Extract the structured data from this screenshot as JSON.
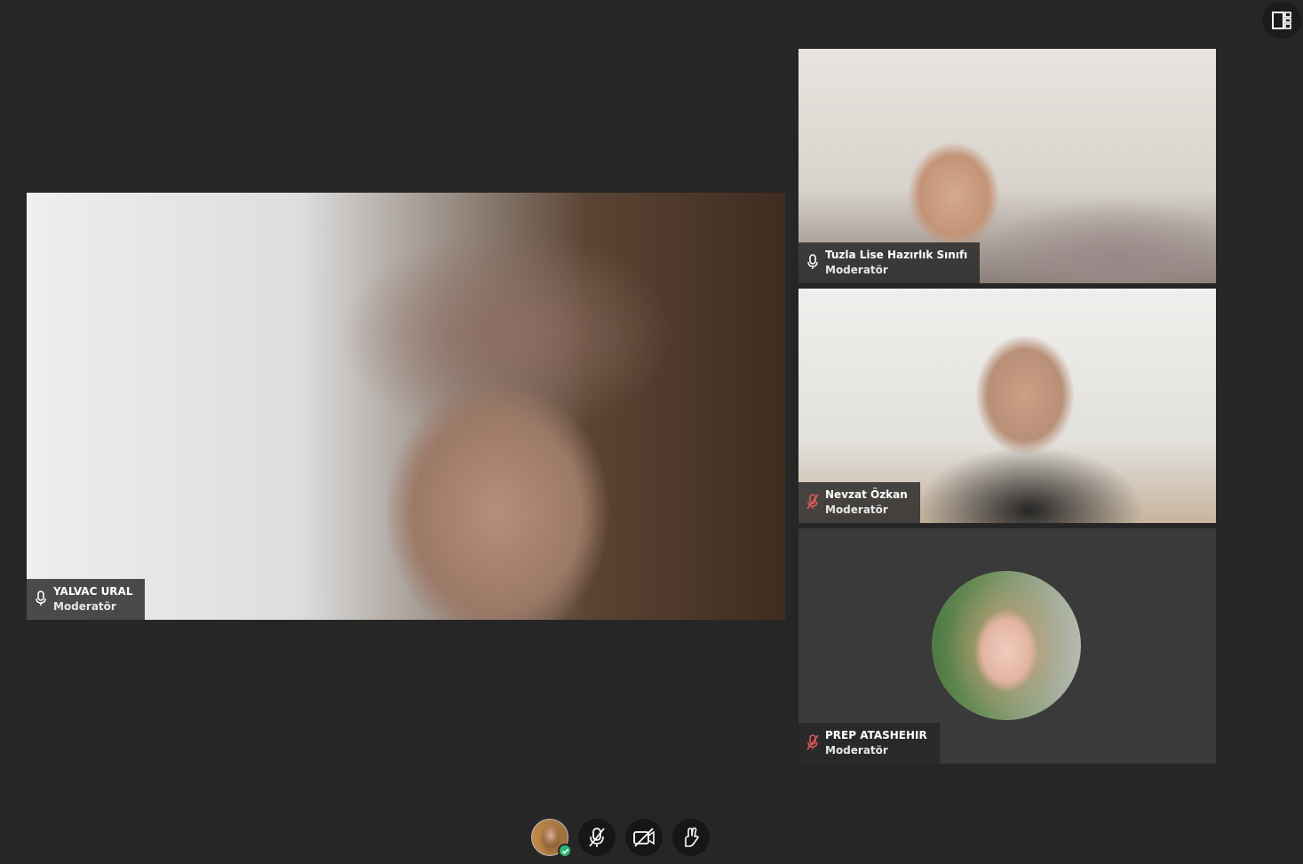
{
  "participants": [
    {
      "name": "YALVAC URAL",
      "role": "Moderatör",
      "mic": "on",
      "camera": "on"
    },
    {
      "name": "Tuzla Lise Hazırlık Sınıfı",
      "role": "Moderatör",
      "mic": "on",
      "camera": "on"
    },
    {
      "name": "Nevzat Özkan",
      "role": "Moderatör",
      "mic": "muted",
      "camera": "on"
    },
    {
      "name": "PREP ATASHEHIR",
      "role": "Moderatör",
      "mic": "muted",
      "camera": "off"
    }
  ],
  "toolbar": {
    "buttons": [
      "user-avatar-status",
      "microphone-muted-icon",
      "camera-off-icon",
      "raise-hand-icon"
    ]
  },
  "colors": {
    "background": "#262626",
    "muted_mic": "#e05a5a",
    "active_mic": "#ffffff",
    "status_ok": "#2eb872"
  }
}
